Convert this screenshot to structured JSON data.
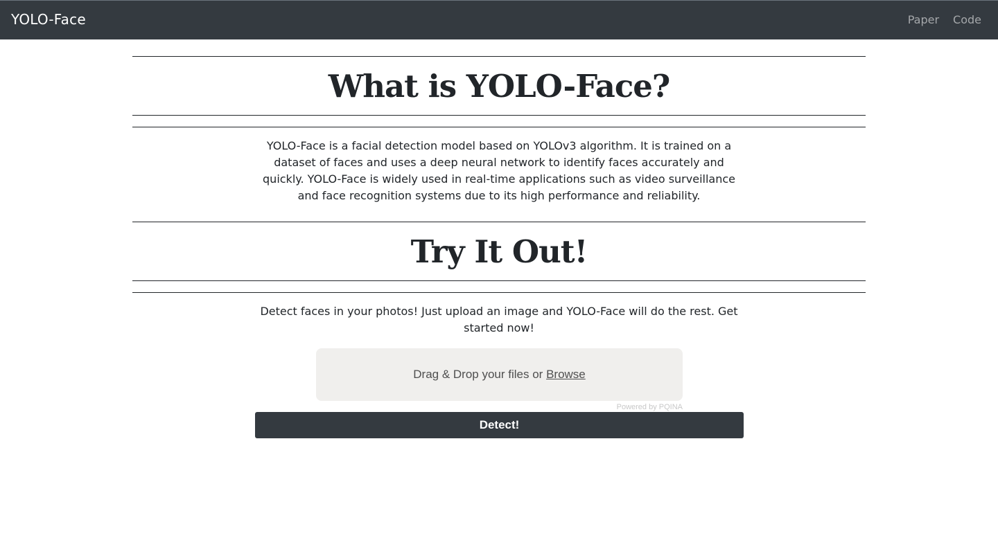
{
  "navbar": {
    "brand": "YOLO-Face",
    "links": [
      {
        "label": "Paper"
      },
      {
        "label": "Code"
      }
    ]
  },
  "about": {
    "title": "What is YOLO-Face?",
    "body": "YOLO-Face is a facial detection model based on YOLOv3 algorithm. It is trained on a dataset of faces and uses a deep neural network to identify faces accurately and quickly. YOLO-Face is widely used in real-time applications such as video surveillance and face recognition systems due to its high performance and reliability."
  },
  "try": {
    "title": "Try It Out!",
    "body": "Detect faces in your photos! Just upload an image and YOLO-Face will do the rest. Get started now!"
  },
  "upload": {
    "prompt": "Drag & Drop your files or",
    "browse_label": "Browse",
    "powered_by": "Powered by PQINA"
  },
  "detect_button": {
    "label": "Detect!"
  },
  "colors": {
    "navbar_bg": "#343a40",
    "dropzone_bg": "#f0efed",
    "button_bg": "#343a40"
  }
}
